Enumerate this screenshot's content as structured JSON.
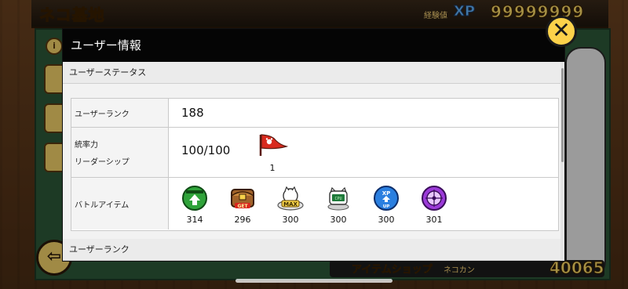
{
  "background": {
    "title": "ネコ基地",
    "xp_label": "経験値",
    "xp_logo": "XP",
    "xp_value": "99999999",
    "shop_label": "アイテムショップ",
    "nekokan_label": "ネコカン",
    "bottom_value": "40065"
  },
  "dialog": {
    "title": "ユーザー情報",
    "close_glyph": "✕",
    "sections": {
      "status_heading": "ユーザーステータス",
      "rank_heading": "ユーザーランク"
    },
    "rows": {
      "user_rank": {
        "label": "ユーザーランク",
        "value": "188"
      },
      "leadership": {
        "label_line1": "統率力",
        "label_line2": "リーダーシップ",
        "value": "100/100",
        "flag_count": "1"
      },
      "battle_items": {
        "label": "バトルアイテム",
        "items": [
          {
            "icon": "speed-up-icon",
            "count": "314"
          },
          {
            "icon": "treasure-radar-icon",
            "count": "296"
          },
          {
            "icon": "rich-cat-icon",
            "count": "300"
          },
          {
            "icon": "cat-cpu-icon",
            "count": "300"
          },
          {
            "icon": "xp-up-icon",
            "count": "300"
          },
          {
            "icon": "sniper-cat-icon",
            "count": "301"
          }
        ]
      }
    }
  },
  "colors": {
    "header_black": "#050505",
    "close_button_yellow": "#fcd24a",
    "flag_red": "#d82a1e"
  }
}
